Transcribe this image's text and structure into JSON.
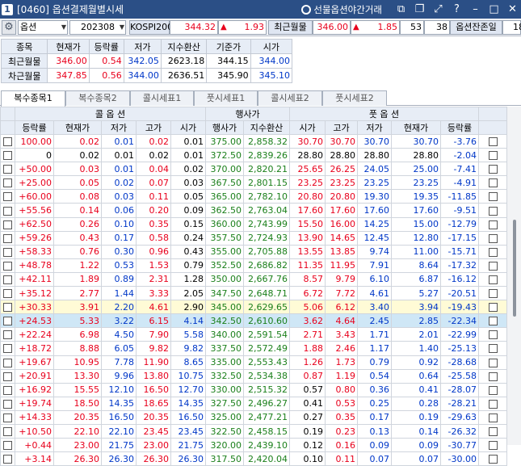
{
  "title": {
    "num": "1",
    "text": "[0460] 옵션결제월별시세",
    "night": "선물옵션야간거래"
  },
  "toolbar": {
    "type": "옵션",
    "month": "202308",
    "index_name": "KOSPI200",
    "index_val": "344.32",
    "index_chg": "1.93",
    "recent_label": "최근월물",
    "recent_val": "346.00",
    "recent_chg": "1.85",
    "n1": "53",
    "n2": "38",
    "remain_label": "옵션잔존일",
    "remain_val": "18"
  },
  "summary": {
    "headers": [
      "종목",
      "현재가",
      "등락률",
      "저가",
      "지수환산",
      "기준가",
      "시가"
    ],
    "rows": [
      [
        "최근월물",
        "346.00",
        "0.54",
        "342.05",
        "2623.18",
        "344.15",
        "344.00"
      ],
      [
        "차근월물",
        "347.85",
        "0.56",
        "344.00",
        "2636.51",
        "345.90",
        "345.10"
      ]
    ]
  },
  "tabs": [
    "복수종목1",
    "복수종목2",
    "콜시세표1",
    "풋시세표1",
    "콜시세표2",
    "풋시세표2"
  ],
  "grid": {
    "call_label": "콜 옵 션",
    "strike_label": "행사가",
    "put_label": "풋 옵 션",
    "headers": [
      "등락률",
      "현재가",
      "저가",
      "고가",
      "시가",
      "행사가",
      "지수환산",
      "시가",
      "고가",
      "저가",
      "현재가",
      "등락률"
    ],
    "rows": [
      [
        "100.00",
        "0.02",
        "0.01",
        "0.02",
        "0.01",
        "375.00",
        "2,858.32",
        "30.70",
        "30.70",
        "30.70",
        "30.70",
        "-3.76"
      ],
      [
        "0",
        "0.02",
        "0.01",
        "0.02",
        "0.01",
        "372.50",
        "2,839.26",
        "28.80",
        "28.80",
        "28.80",
        "28.80",
        "-2.04"
      ],
      [
        "+50.00",
        "0.03",
        "0.01",
        "0.04",
        "0.02",
        "370.00",
        "2,820.21",
        "25.65",
        "26.25",
        "24.05",
        "25.00",
        "-7.41"
      ],
      [
        "+25.00",
        "0.05",
        "0.02",
        "0.07",
        "0.03",
        "367.50",
        "2,801.15",
        "23.25",
        "23.25",
        "23.25",
        "23.25",
        "-4.91"
      ],
      [
        "+60.00",
        "0.08",
        "0.03",
        "0.11",
        "0.05",
        "365.00",
        "2,782.10",
        "20.80",
        "20.80",
        "19.30",
        "19.35",
        "-11.85"
      ],
      [
        "+55.56",
        "0.14",
        "0.06",
        "0.20",
        "0.09",
        "362.50",
        "2,763.04",
        "17.60",
        "17.60",
        "17.60",
        "17.60",
        "-9.51"
      ],
      [
        "+62.50",
        "0.26",
        "0.10",
        "0.35",
        "0.15",
        "360.00",
        "2,743.99",
        "15.50",
        "16.00",
        "14.25",
        "15.00",
        "-12.79"
      ],
      [
        "+59.26",
        "0.43",
        "0.17",
        "0.58",
        "0.24",
        "357.50",
        "2,724.93",
        "13.90",
        "14.65",
        "12.45",
        "12.80",
        "-17.15"
      ],
      [
        "+58.33",
        "0.76",
        "0.30",
        "0.96",
        "0.43",
        "355.00",
        "2,705.88",
        "13.55",
        "13.85",
        "9.74",
        "11.00",
        "-15.71"
      ],
      [
        "+48.78",
        "1.22",
        "0.53",
        "1.53",
        "0.79",
        "352.50",
        "2,686.82",
        "11.35",
        "11.95",
        "7.91",
        "8.64",
        "-17.32"
      ],
      [
        "+42.11",
        "1.89",
        "0.89",
        "2.31",
        "1.28",
        "350.00",
        "2,667.76",
        "8.57",
        "9.79",
        "6.10",
        "6.87",
        "-16.12"
      ],
      [
        "+35.12",
        "2.77",
        "1.44",
        "3.33",
        "2.05",
        "347.50",
        "2,648.71",
        "6.72",
        "7.72",
        "4.61",
        "5.27",
        "-20.51"
      ],
      [
        "+30.33",
        "3.91",
        "2.20",
        "4.61",
        "2.90",
        "345.00",
        "2,629.65",
        "5.06",
        "6.12",
        "3.40",
        "3.94",
        "-19.43"
      ],
      [
        "+24.53",
        "5.33",
        "3.22",
        "6.15",
        "4.14",
        "342.50",
        "2,610.60",
        "3.62",
        "4.64",
        "2.45",
        "2.85",
        "-22.34"
      ],
      [
        "+22.24",
        "6.98",
        "4.50",
        "7.90",
        "5.58",
        "340.00",
        "2,591.54",
        "2.71",
        "3.43",
        "1.71",
        "2.01",
        "-22.99"
      ],
      [
        "+18.72",
        "8.88",
        "6.05",
        "9.82",
        "9.82",
        "337.50",
        "2,572.49",
        "1.88",
        "2.46",
        "1.17",
        "1.40",
        "-25.13"
      ],
      [
        "+19.67",
        "10.95",
        "7.78",
        "11.90",
        "8.65",
        "335.00",
        "2,553.43",
        "1.26",
        "1.73",
        "0.79",
        "0.92",
        "-28.68"
      ],
      [
        "+20.91",
        "13.30",
        "9.96",
        "13.80",
        "10.75",
        "332.50",
        "2,534.38",
        "0.87",
        "1.19",
        "0.54",
        "0.64",
        "-25.58"
      ],
      [
        "+16.92",
        "15.55",
        "12.10",
        "16.50",
        "12.70",
        "330.00",
        "2,515.32",
        "0.57",
        "0.80",
        "0.36",
        "0.41",
        "-28.07"
      ],
      [
        "+19.74",
        "18.50",
        "14.35",
        "18.65",
        "14.35",
        "327.50",
        "2,496.27",
        "0.41",
        "0.53",
        "0.25",
        "0.28",
        "-28.21"
      ],
      [
        "+14.33",
        "20.35",
        "16.50",
        "20.35",
        "16.50",
        "325.00",
        "2,477.21",
        "0.27",
        "0.35",
        "0.17",
        "0.19",
        "-29.63"
      ],
      [
        "+10.50",
        "22.10",
        "22.10",
        "23.45",
        "23.45",
        "322.50",
        "2,458.15",
        "0.19",
        "0.23",
        "0.13",
        "0.14",
        "-26.32"
      ],
      [
        "+0.44",
        "23.00",
        "21.75",
        "23.00",
        "21.75",
        "320.00",
        "2,439.10",
        "0.12",
        "0.16",
        "0.09",
        "0.09",
        "-30.77"
      ],
      [
        "+3.14",
        "26.30",
        "26.30",
        "26.30",
        "26.30",
        "317.50",
        "2,420.04",
        "0.10",
        "0.11",
        "0.07",
        "0.07",
        "-30.00"
      ]
    ]
  },
  "colors": {
    "up": "#e8001c",
    "down": "#0037c8",
    "strike": "#1a7f1a",
    "header_bg": "#e7edf6",
    "title_bg": "#2b4f86",
    "highlight": "#fffbd6",
    "atm": "#cfe7f6"
  }
}
